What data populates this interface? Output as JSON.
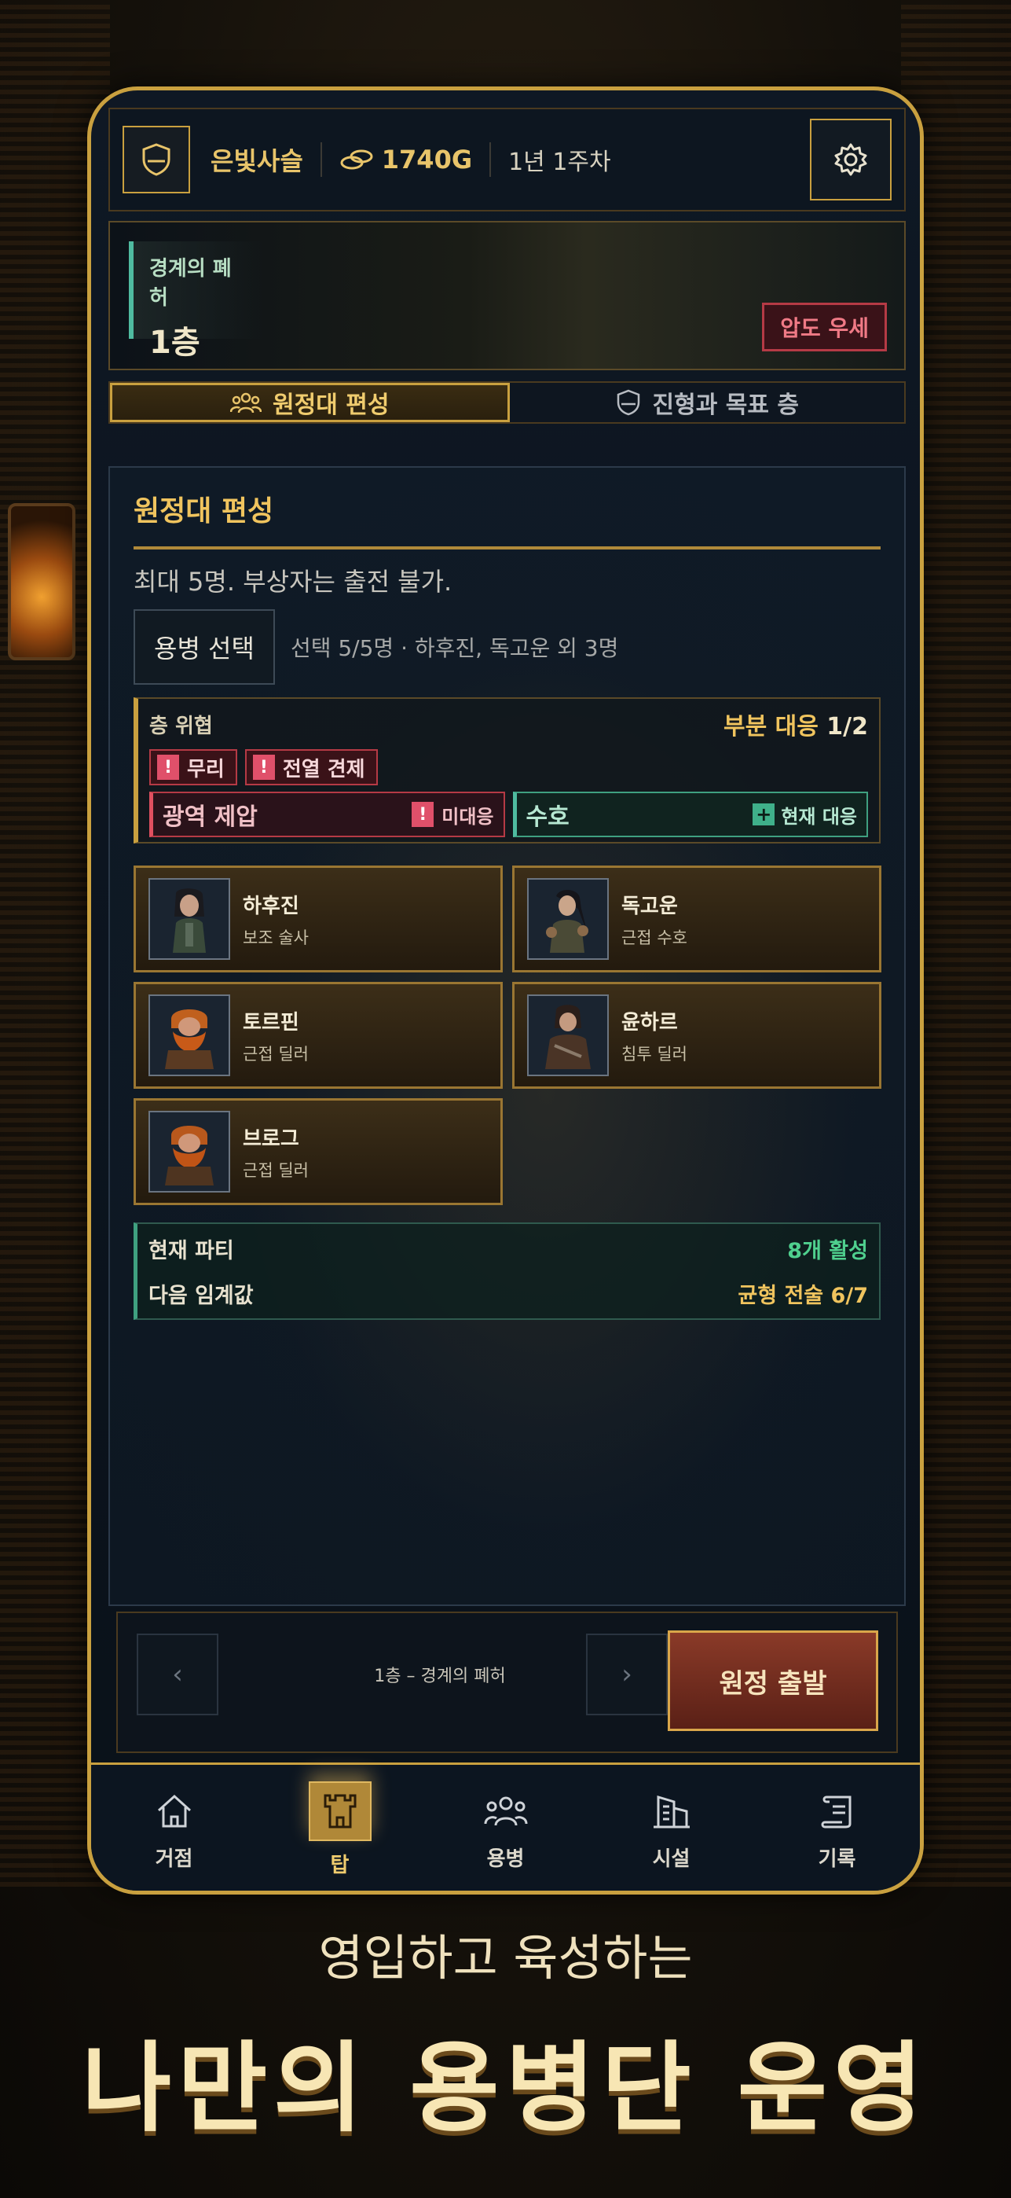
{
  "header": {
    "guild_name": "은빛사슬",
    "gold": "1740G",
    "date": "1년 1주차",
    "shield_icon": "shield-icon",
    "coin_icon": "coins-icon",
    "settings_icon": "gear-icon"
  },
  "floor": {
    "name": "경계의 폐허",
    "number": "1층",
    "status_badge": "압도 우세"
  },
  "tabs": [
    {
      "label": "원정대 편성",
      "icon": "party-icon",
      "active": true
    },
    {
      "label": "진형과 목표 층",
      "icon": "shield-icon",
      "active": false
    }
  ],
  "panel": {
    "title": "원정대 편성",
    "description": "최대 5명. 부상자는 출전 불가.",
    "select_button": "용병 선택",
    "selection_summary": "선택 5/5명 · 하후진, 독고운 외 3명"
  },
  "threat": {
    "label": "층 위협",
    "coverage_label": "부분 대응",
    "coverage_count": "1/2",
    "chips": [
      "무리",
      "전열 견제"
    ],
    "unmet": {
      "name": "광역 제압",
      "status": "미대응"
    },
    "met": {
      "name": "수호",
      "status": "현재 대응"
    }
  },
  "mercenaries": [
    {
      "name": "하후진",
      "role": "보조 술사"
    },
    {
      "name": "독고운",
      "role": "근접 수호"
    },
    {
      "name": "토르핀",
      "role": "근접 딜러"
    },
    {
      "name": "윤하르",
      "role": "침투 딜러"
    },
    {
      "name": "브로그",
      "role": "근접 딜러"
    }
  ],
  "party": {
    "current_label": "현재 파티",
    "current_value": "8개 활성",
    "next_label": "다음 임계값",
    "next_value": "균형 전술 6/7"
  },
  "action_bar": {
    "prev_arrow": "‹",
    "next_arrow": "›",
    "caption": "1층 – 경계의 폐허",
    "depart_button": "원정 출발"
  },
  "bottom_nav": [
    {
      "label": "거점",
      "icon": "home-icon",
      "active": false
    },
    {
      "label": "탑",
      "icon": "tower-icon",
      "active": true
    },
    {
      "label": "용병",
      "icon": "mercenary-icon",
      "active": false
    },
    {
      "label": "시설",
      "icon": "building-icon",
      "active": false
    },
    {
      "label": "기록",
      "icon": "scroll-icon",
      "active": false
    }
  ],
  "promo": {
    "tagline": "영입하고 육성하는",
    "headline": "나만의 용병단 운영"
  },
  "colors": {
    "accent_gold": "#c9a03f",
    "danger": "#b53a45",
    "positive": "#3fa080",
    "panel_bg": "#0f1a26"
  }
}
